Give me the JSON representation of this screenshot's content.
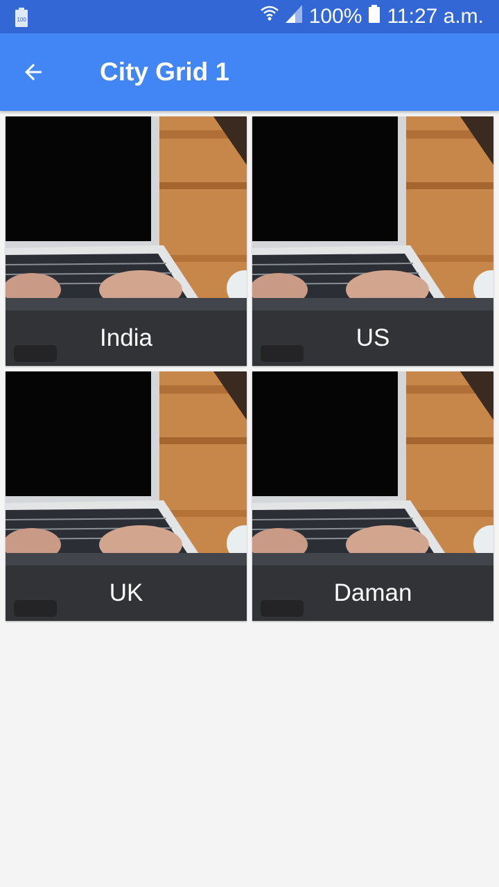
{
  "status_bar": {
    "battery_badge": "100",
    "battery_percent": "100%",
    "time": "11:27 a.m."
  },
  "app_bar": {
    "title": "City Grid 1",
    "back_icon": "arrow-left-icon"
  },
  "grid": {
    "items": [
      {
        "label": "India"
      },
      {
        "label": "US"
      },
      {
        "label": "UK"
      },
      {
        "label": "Daman"
      }
    ]
  },
  "colors": {
    "status_bar": "#3367d6",
    "app_bar": "#4285f4",
    "background": "#f4f4f4"
  }
}
